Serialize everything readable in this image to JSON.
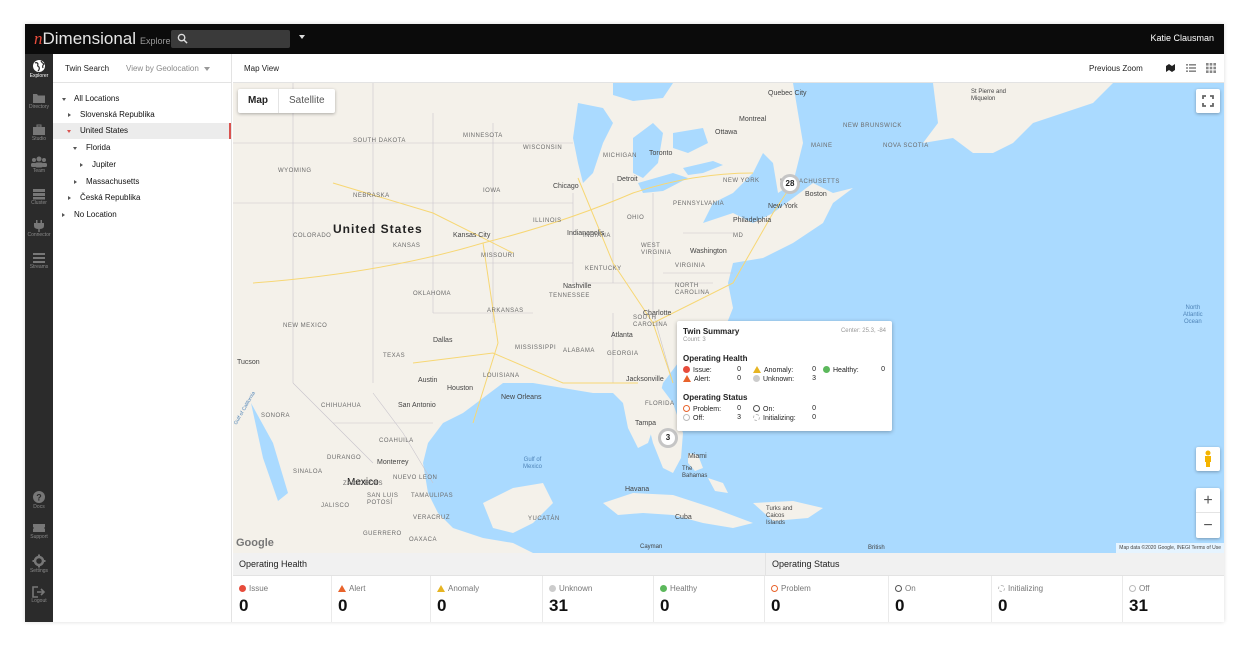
{
  "app": {
    "logo_n": "n",
    "logo_rest": "Dimensional",
    "logo_sub": "Explorer",
    "user": "Katie Clausman"
  },
  "rail": [
    {
      "label": "Explorer",
      "icon": "globe-icon"
    },
    {
      "label": "Directory",
      "icon": "folder-icon"
    },
    {
      "label": "Studio",
      "icon": "briefcase-icon"
    },
    {
      "label": "Team",
      "icon": "team-icon"
    },
    {
      "label": "Cluster",
      "icon": "cluster-icon"
    },
    {
      "label": "Connector",
      "icon": "plug-icon"
    },
    {
      "label": "Streams",
      "icon": "streams-icon"
    },
    {
      "label": "Docs",
      "icon": "help-icon"
    },
    {
      "label": "Support",
      "icon": "ticket-icon"
    },
    {
      "label": "Settings",
      "icon": "gear-icon"
    },
    {
      "label": "Logout",
      "icon": "logout-icon"
    }
  ],
  "left_panel": {
    "tab": "Twin Search",
    "view_select": "View by Geolocation",
    "tree": [
      {
        "label": "All Locations",
        "expanded": true
      },
      {
        "label": "Slovenská Republika",
        "expanded": false
      },
      {
        "label": "United States",
        "expanded": true,
        "selected": true
      },
      {
        "label": "Florida",
        "expanded": true
      },
      {
        "label": "Jupiter",
        "expanded": false
      },
      {
        "label": "Massachusetts",
        "expanded": false
      },
      {
        "label": "Česká Republika",
        "expanded": false
      },
      {
        "label": "No Location",
        "expanded": false
      }
    ]
  },
  "main_header": {
    "title": "Map View",
    "previous_zoom": "Previous Zoom"
  },
  "map": {
    "type_map": "Map",
    "type_satellite": "Satellite",
    "zoom_in": "+",
    "zoom_out": "−",
    "google": "Google",
    "attribution": "Map data ©2020 Google, INEGI   Terms of Use",
    "clusters": [
      {
        "count": "28"
      },
      {
        "count": "3"
      }
    ],
    "labels": {
      "united_states": "United States",
      "mexico": "Mexico",
      "north_atlantic": "North\nAtlantic\nOcean",
      "gulf": "Gulf of\nMexico",
      "gulf_california": "Gulf of California",
      "quebec_city": "Quebec City",
      "montreal": "Montreal",
      "ottawa": "Ottawa",
      "toronto": "Toronto",
      "detroit": "Detroit",
      "chicago": "Chicago",
      "boston": "Boston",
      "new_york": "New York",
      "philadelphia": "Philadelphia",
      "washington": "Washington",
      "charlotte": "Charlotte",
      "atlanta": "Atlanta",
      "nashville": "Nashville",
      "indianapolis": "Indianapolis",
      "kansas_city": "Kansas City",
      "dallas": "Dallas",
      "houston": "Houston",
      "austin": "Austin",
      "san_antonio": "San Antonio",
      "new_orleans": "New Orleans",
      "jacksonville": "Jacksonville",
      "tampa": "Tampa",
      "miami": "Miami",
      "monterrey": "Monterrey",
      "tucson": "Tucson",
      "havana": "Havana",
      "cuba": "Cuba",
      "the_bahamas": "The\nBahamas",
      "cayman": "Cayman",
      "turks": "Turks and\nCaicos\nIslands",
      "british": "British",
      "st_pierre": "St Pierre and\nMiquelon",
      "nebraska": "NEBRASKA",
      "kansas": "KANSAS",
      "iowa": "IOWA",
      "illinois": "ILLINOIS",
      "missouri": "MISSOURI",
      "oklahoma": "OKLAHOMA",
      "texas": "TEXAS",
      "new_mexico": "NEW MEXICO",
      "wyoming": "WYOMING",
      "colorado": "COLORADO",
      "south_dakota": "SOUTH DAKOTA",
      "wisconsin": "WISCONSIN",
      "michigan": "MICHIGAN",
      "ohio": "OHIO",
      "kentucky": "KENTUCKY",
      "tennessee": "TENNESSEE",
      "arkansas": "ARKANSAS",
      "mississippi": "MISSISSIPPI",
      "alabama": "ALABAMA",
      "georgia": "GEORGIA",
      "louisiana": "LOUISIANA",
      "florida": "FLORIDA",
      "virginia": "VIRGINIA",
      "pennsylvania": "PENNSYLVANIA",
      "new_york_state": "NEW YORK",
      "maine": "MAINE",
      "massachusetts": "MASSACHUSETTS",
      "nova_scotia": "NOVA SCOTIA",
      "new_brunswick": "NEW BRUNSWICK",
      "sonora": "SONORA",
      "chihuahua": "CHIHUAHUA",
      "coahuila": "COAHUILA",
      "durango": "DURANGO",
      "sinaloa": "SINALOA",
      "nuevo_leon": "NUEVO LEON",
      "jalisco": "JALISCO",
      "guerrero": "GUERRERO",
      "oaxaca": "OAXACA",
      "yucatan": "YUCATÁN",
      "veracruz": "VERACRUZ",
      "tamaulipas": "TAMAULIPAS",
      "san_luis": "SAN LUIS\nPOTOSÍ",
      "zacatecas": "ZACATECAS",
      "north_carolina": "NORTH\nCAROLINA",
      "south_carolina": "SOUTH\nCAROLINA",
      "west_virginia": "WEST\nVIRGINIA",
      "indiana": "INDIANA",
      "minnesota": "MINNESOTA",
      "maryland": "MD"
    }
  },
  "popup": {
    "title": "Twin Summary",
    "count": "Count: 3",
    "center": "Center: 25.3, -84",
    "health_title": "Operating Health",
    "issue_label": "Issue:",
    "issue_value": "0",
    "alert_label": "Alert:",
    "alert_value": "0",
    "anomaly_label": "Anomaly:",
    "anomaly_value": "0",
    "unknown_label": "Unknown:",
    "unknown_value": "3",
    "healthy_label": "Healthy:",
    "healthy_value": "0",
    "status_title": "Operating Status",
    "problem_label": "Problem:",
    "problem_value": "0",
    "off_label": "Off:",
    "off_value": "3",
    "on_label": "On:",
    "on_value": "0",
    "init_label": "Initializing:",
    "init_value": "0"
  },
  "stats": {
    "health_title": "Operating Health",
    "status_title": "Operating Status",
    "health": [
      {
        "label": "Issue",
        "value": "0"
      },
      {
        "label": "Alert",
        "value": "0"
      },
      {
        "label": "Anomaly",
        "value": "0"
      },
      {
        "label": "Unknown",
        "value": "31"
      },
      {
        "label": "Healthy",
        "value": "0"
      }
    ],
    "status": [
      {
        "label": "Problem",
        "value": "0"
      },
      {
        "label": "On",
        "value": "0"
      },
      {
        "label": "Initializing",
        "value": "0"
      },
      {
        "label": "Off",
        "value": "31"
      }
    ]
  },
  "colors": {
    "issue": "#e74c3c",
    "alert": "#e8632b",
    "anomaly": "#e6b422",
    "unknown": "#bbbbbb",
    "healthy": "#5cb85c",
    "water": "#aadaff",
    "land": "#f4f1ea",
    "selected_marker": "#d9534f"
  }
}
